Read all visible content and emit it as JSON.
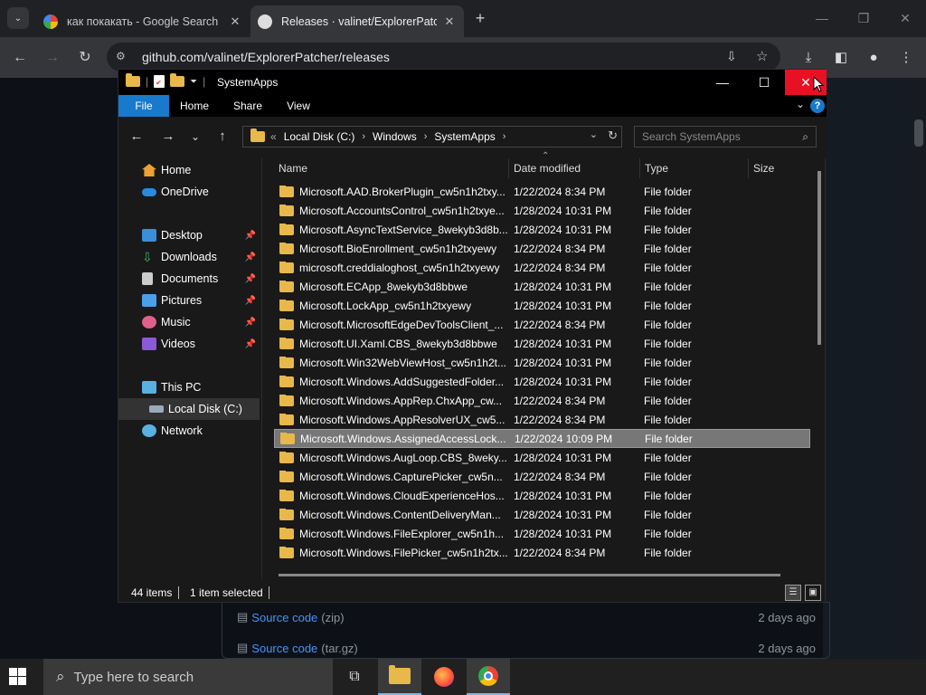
{
  "browser": {
    "tabs": [
      {
        "title": "как покакать - Google Search",
        "active": false
      },
      {
        "title": "Releases · valinet/ExplorerPatcher",
        "active": true
      }
    ],
    "url": "github.com/valinet/ExplorerPatcher/releases"
  },
  "github": {
    "assets": [
      {
        "label": "Source code",
        "suffix": "(zip)",
        "date": "2 days ago"
      },
      {
        "label": "Source code",
        "suffix": "(tar.gz)",
        "date": "2 days ago"
      }
    ]
  },
  "explorer": {
    "title": "SystemApps",
    "ribbon_tabs": [
      "File",
      "Home",
      "Share",
      "View"
    ],
    "address": {
      "prefix": "«",
      "segments": [
        "Local Disk (C:)",
        "Windows",
        "SystemApps"
      ]
    },
    "search_placeholder": "Search SystemApps",
    "nav": {
      "home": "Home",
      "onedrive": "OneDrive",
      "desktop": "Desktop",
      "downloads": "Downloads",
      "documents": "Documents",
      "pictures": "Pictures",
      "music": "Music",
      "videos": "Videos",
      "thispc": "This PC",
      "localdisk": "Local Disk (C:)",
      "network": "Network"
    },
    "columns": {
      "name": "Name",
      "date": "Date modified",
      "type": "Type",
      "size": "Size"
    },
    "files": [
      {
        "name": "Microsoft.AAD.BrokerPlugin_cw5n1h2txy...",
        "date": "1/22/2024 8:34 PM",
        "type": "File folder"
      },
      {
        "name": "Microsoft.AccountsControl_cw5n1h2txye...",
        "date": "1/28/2024 10:31 PM",
        "type": "File folder"
      },
      {
        "name": "Microsoft.AsyncTextService_8wekyb3d8b...",
        "date": "1/28/2024 10:31 PM",
        "type": "File folder"
      },
      {
        "name": "Microsoft.BioEnrollment_cw5n1h2txyewy",
        "date": "1/22/2024 8:34 PM",
        "type": "File folder"
      },
      {
        "name": "microsoft.creddialoghost_cw5n1h2txyewy",
        "date": "1/22/2024 8:34 PM",
        "type": "File folder"
      },
      {
        "name": "Microsoft.ECApp_8wekyb3d8bbwe",
        "date": "1/28/2024 10:31 PM",
        "type": "File folder"
      },
      {
        "name": "Microsoft.LockApp_cw5n1h2txyewy",
        "date": "1/28/2024 10:31 PM",
        "type": "File folder"
      },
      {
        "name": "Microsoft.MicrosoftEdgeDevToolsClient_...",
        "date": "1/22/2024 8:34 PM",
        "type": "File folder"
      },
      {
        "name": "Microsoft.UI.Xaml.CBS_8wekyb3d8bbwe",
        "date": "1/28/2024 10:31 PM",
        "type": "File folder"
      },
      {
        "name": "Microsoft.Win32WebViewHost_cw5n1h2t...",
        "date": "1/28/2024 10:31 PM",
        "type": "File folder"
      },
      {
        "name": "Microsoft.Windows.AddSuggestedFolder...",
        "date": "1/28/2024 10:31 PM",
        "type": "File folder"
      },
      {
        "name": "Microsoft.Windows.AppRep.ChxApp_cw...",
        "date": "1/22/2024 8:34 PM",
        "type": "File folder"
      },
      {
        "name": "Microsoft.Windows.AppResolverUX_cw5...",
        "date": "1/22/2024 8:34 PM",
        "type": "File folder"
      },
      {
        "name": "Microsoft.Windows.AssignedAccessLock...",
        "date": "1/22/2024 10:09 PM",
        "type": "File folder",
        "selected": true
      },
      {
        "name": "Microsoft.Windows.AugLoop.CBS_8weky...",
        "date": "1/28/2024 10:31 PM",
        "type": "File folder"
      },
      {
        "name": "Microsoft.Windows.CapturePicker_cw5n...",
        "date": "1/22/2024 8:34 PM",
        "type": "File folder"
      },
      {
        "name": "Microsoft.Windows.CloudExperienceHos...",
        "date": "1/28/2024 10:31 PM",
        "type": "File folder"
      },
      {
        "name": "Microsoft.Windows.ContentDeliveryMan...",
        "date": "1/28/2024 10:31 PM",
        "type": "File folder"
      },
      {
        "name": "Microsoft.Windows.FileExplorer_cw5n1h...",
        "date": "1/28/2024 10:31 PM",
        "type": "File folder"
      },
      {
        "name": "Microsoft.Windows.FilePicker_cw5n1h2tx...",
        "date": "1/22/2024 8:34 PM",
        "type": "File folder"
      }
    ],
    "status": {
      "count": "44 items",
      "selected": "1 item selected"
    }
  },
  "taskbar": {
    "search_placeholder": "Type here to search"
  }
}
